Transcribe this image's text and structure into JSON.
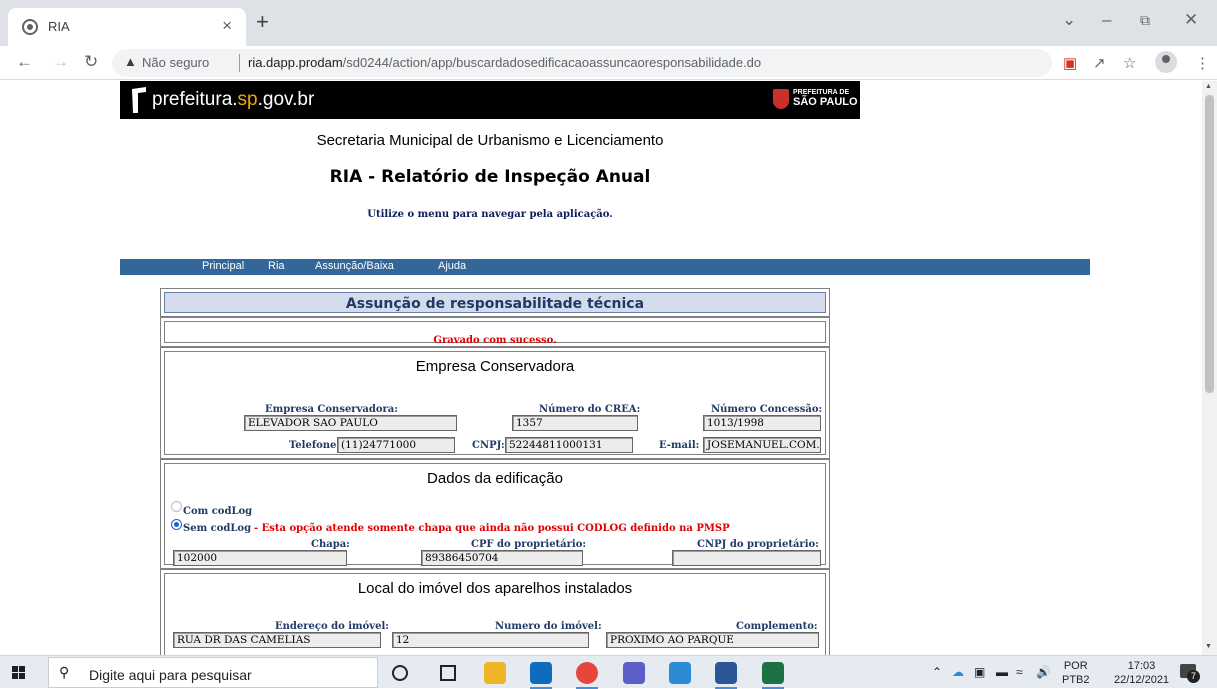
{
  "browser": {
    "tab_title": "RIA",
    "tab_close": "×",
    "new_tab": "+",
    "not_secure": "Não seguro",
    "url_host": "ria.dapp.prodam",
    "url_path": "/sd0244/action/app/buscardadosedificacaoassuncaoresponsabilidade.do",
    "icons": [
      "back-icon",
      "forward-icon",
      "reload-icon",
      "warning-icon",
      "cast-icon",
      "share-icon",
      "star-icon",
      "profile-icon",
      "kebab-menu-icon"
    ]
  },
  "brand": {
    "site_prefix": "prefeitura.",
    "site_sp": "sp",
    "site_suffix": ".gov.br",
    "logo_line1": "PREFEITURA DE",
    "logo_line2": "SÃO PAULO"
  },
  "page": {
    "secretaria": "Secretaria Municipal de Urbanismo e Licenciamento",
    "title": "RIA - Relatório de Inspeção Anual",
    "hint": "Utilize o menu para navegar pela aplicação."
  },
  "menu": {
    "principal": "Principal",
    "ria": "Ria",
    "assuncao": "Assunção/Baixa",
    "ajuda": "Ajuda"
  },
  "form": {
    "header": "Assunção de responsabilitade técnica",
    "success": "Gravado com sucesso.",
    "empresa": {
      "section_title": "Empresa Conservadora",
      "empresa_label": "Empresa Conservadora:",
      "empresa_value": "ELEVADOR SAO PAULO",
      "crea_label": "Número do CREA:",
      "crea_value": "1357",
      "concessao_label": "Número Concessão:",
      "concessao_value": "1013/1998",
      "telefone_label": "Telefone:",
      "telefone_value": "(11)24771000",
      "cnpj_label": "CNPJ:",
      "cnpj_value": "52244811000131",
      "email_label": "E-mail:",
      "email_value": "JOSEMANUEL.COM.B"
    },
    "edificacao": {
      "section_title": "Dados da edificação",
      "com_codlog": "Com codLog",
      "sem_codlog": "Sem codLog",
      "sem_codlog_note": " - Esta opção atende somente chapa que ainda não possui CODLOG definido na PMSP",
      "selected": "sem_codlog",
      "chapa_label": "Chapa:",
      "chapa_value": "102000",
      "cpf_label": "CPF do proprietário:",
      "cpf_value": "89386450704",
      "cnpj_prop_label": "CNPJ do proprietário:",
      "cnpj_prop_value": ""
    },
    "local": {
      "section_title": "Local do imóvel dos aparelhos instalados",
      "endereco_label": "Endereço do imóvel:",
      "endereco_value": "RUA DR DAS CAMELIAS",
      "numero_label": "Numero do imóvel:",
      "numero_value": "12",
      "complemento_label": "Complemento:",
      "complemento_value": "PROXIMO AO PARQUE"
    }
  },
  "taskbar": {
    "search_placeholder": "Digite aqui para pesquisar",
    "lang_line1": "POR",
    "lang_line2": "PTB2",
    "time": "17:03",
    "date": "22/12/2021",
    "notif_count": "7"
  }
}
